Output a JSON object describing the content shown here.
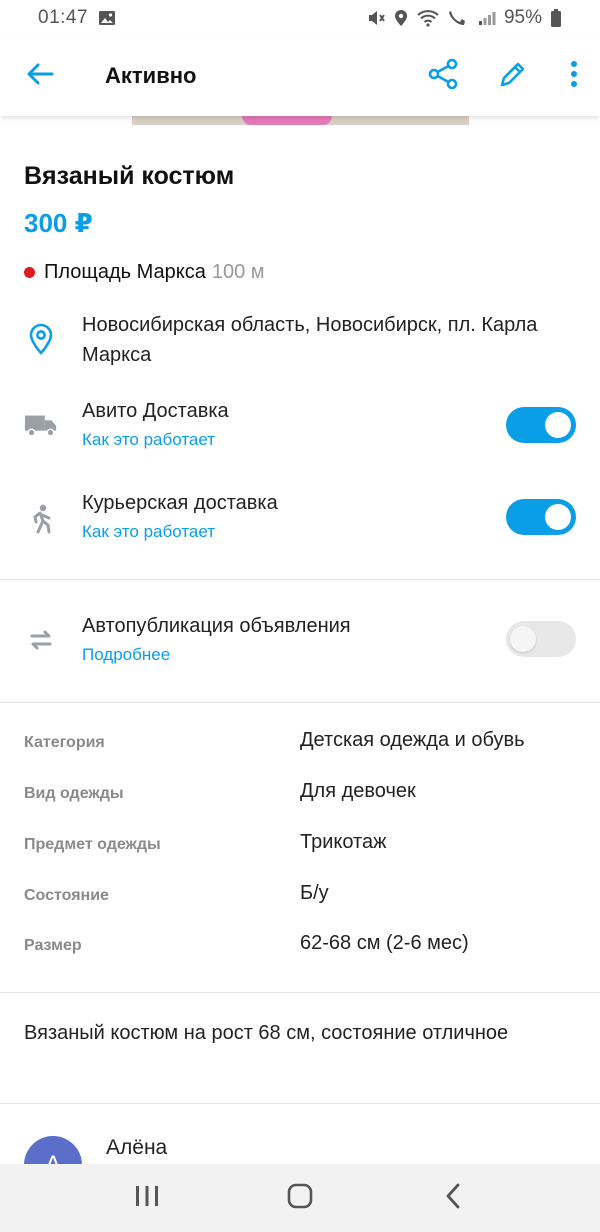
{
  "status_bar": {
    "time": "01:47",
    "battery": "95%"
  },
  "app_bar": {
    "title": "Активно"
  },
  "listing": {
    "title": "Вязаный костюм",
    "price": "300 ₽",
    "metro": {
      "station": "Площадь Маркса",
      "distance": "100 м",
      "color": "#e01b1b"
    }
  },
  "address": {
    "text": "Новосибирская область, Новосибирск, пл. Карла Маркса"
  },
  "delivery": [
    {
      "label": "Авито Доставка",
      "link": "Как это работает",
      "enabled": true
    },
    {
      "label": "Курьерская доставка",
      "link": "Как это работает",
      "enabled": true
    }
  ],
  "autopublish": {
    "label": "Автопубликация объявления",
    "link": "Подробнее",
    "enabled": false
  },
  "params": [
    {
      "key": "Категория",
      "value": "Детская одежда и обувь"
    },
    {
      "key": "Вид одежды",
      "value": "Для девочек"
    },
    {
      "key": "Предмет одежды",
      "value": "Трикотаж"
    },
    {
      "key": "Состояние",
      "value": "Б/у"
    },
    {
      "key": "Размер",
      "value": "62-68 см (2-6 мес)"
    }
  ],
  "description": "Вязаный костюм на рост 68 см, состояние отличное",
  "seller": {
    "name": "Алёна",
    "initial": "А"
  },
  "colors": {
    "accent": "#0a9ee6",
    "metro_dot": "#e01b1b",
    "avatar": "#5b6ec9"
  },
  "icons": {
    "app_bar": [
      "back-arrow-icon",
      "share-icon",
      "edit-icon",
      "more-vertical-icon"
    ],
    "rows": [
      "location-pin-icon",
      "truck-icon",
      "courier-icon",
      "autorenew-icon"
    ],
    "nav": [
      "recents-icon",
      "home-icon",
      "back-icon"
    ]
  }
}
